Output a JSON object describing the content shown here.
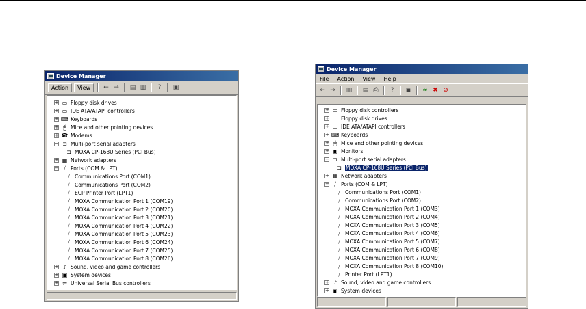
{
  "left_window": {
    "title": "Device Manager",
    "toolbar": {
      "action": "Action",
      "view": "View"
    },
    "items": [
      {
        "label": "Floppy disk drives",
        "level": 0,
        "exp": "+",
        "icon": "floppy-drive-icon",
        "glyph": "▭"
      },
      {
        "label": "IDE ATA/ATAPI controllers",
        "level": 0,
        "exp": "+",
        "icon": "ide-controller-icon",
        "glyph": "▭"
      },
      {
        "label": "Keyboards",
        "level": 0,
        "exp": "+",
        "icon": "keyboard-icon",
        "glyph": "⌨"
      },
      {
        "label": "Mice and other pointing devices",
        "level": 0,
        "exp": "+",
        "icon": "mouse-icon",
        "glyph": "🖱"
      },
      {
        "label": "Modems",
        "level": 0,
        "exp": "+",
        "icon": "modem-icon",
        "glyph": "☎"
      },
      {
        "label": "Multi-port serial adapters",
        "level": 0,
        "exp": "−",
        "icon": "serial-adapter-icon",
        "glyph": "⊐"
      },
      {
        "label": "MOXA CP-168U Series (PCI Bus)",
        "level": 1,
        "exp": "",
        "icon": "serial-adapter-icon",
        "glyph": "⊐"
      },
      {
        "label": "Network adapters",
        "level": 0,
        "exp": "+",
        "icon": "network-adapter-icon",
        "glyph": "▦"
      },
      {
        "label": "Ports (COM & LPT)",
        "level": 0,
        "exp": "−",
        "icon": "port-icon",
        "glyph": "⧸"
      },
      {
        "label": "Communications Port (COM1)",
        "level": 1,
        "exp": "",
        "icon": "port-icon",
        "glyph": "⧸"
      },
      {
        "label": "Communications Port (COM2)",
        "level": 1,
        "exp": "",
        "icon": "port-icon",
        "glyph": "⧸"
      },
      {
        "label": "ECP Printer Port (LPT1)",
        "level": 1,
        "exp": "",
        "icon": "port-icon",
        "glyph": "⧸"
      },
      {
        "label": "MOXA Communication Port 1 (COM19)",
        "level": 1,
        "exp": "",
        "icon": "port-icon",
        "glyph": "⧸"
      },
      {
        "label": "MOXA Communication Port 2 (COM20)",
        "level": 1,
        "exp": "",
        "icon": "port-icon",
        "glyph": "⧸"
      },
      {
        "label": "MOXA Communication Port 3 (COM21)",
        "level": 1,
        "exp": "",
        "icon": "port-icon",
        "glyph": "⧸"
      },
      {
        "label": "MOXA Communication Port 4 (COM22)",
        "level": 1,
        "exp": "",
        "icon": "port-icon",
        "glyph": "⧸"
      },
      {
        "label": "MOXA Communication Port 5 (COM23)",
        "level": 1,
        "exp": "",
        "icon": "port-icon",
        "glyph": "⧸"
      },
      {
        "label": "MOXA Communication Port 6 (COM24)",
        "level": 1,
        "exp": "",
        "icon": "port-icon",
        "glyph": "⧸"
      },
      {
        "label": "MOXA Communication Port 7 (COM25)",
        "level": 1,
        "exp": "",
        "icon": "port-icon",
        "glyph": "⧸"
      },
      {
        "label": "MOXA Communication Port 8 (COM26)",
        "level": 1,
        "exp": "",
        "icon": "port-icon",
        "glyph": "⧸"
      },
      {
        "label": "Sound, video and game controllers",
        "level": 0,
        "exp": "+",
        "icon": "sound-icon",
        "glyph": "♪"
      },
      {
        "label": "System devices",
        "level": 0,
        "exp": "+",
        "icon": "system-device-icon",
        "glyph": "▣"
      },
      {
        "label": "Universal Serial Bus controllers",
        "level": 0,
        "exp": "+",
        "icon": "usb-icon",
        "glyph": "⇌"
      }
    ]
  },
  "right_window": {
    "title": "Device Manager",
    "menu": {
      "file": "File",
      "action": "Action",
      "view": "View",
      "help": "Help"
    },
    "items": [
      {
        "label": "Floppy disk controllers",
        "level": 0,
        "exp": "+",
        "icon": "floppy-controller-icon",
        "glyph": "▭",
        "selected": false
      },
      {
        "label": "Floppy disk drives",
        "level": 0,
        "exp": "+",
        "icon": "floppy-drive-icon",
        "glyph": "▭",
        "selected": false
      },
      {
        "label": "IDE ATA/ATAPI controllers",
        "level": 0,
        "exp": "+",
        "icon": "ide-controller-icon",
        "glyph": "▭",
        "selected": false
      },
      {
        "label": "Keyboards",
        "level": 0,
        "exp": "+",
        "icon": "keyboard-icon",
        "glyph": "⌨",
        "selected": false
      },
      {
        "label": "Mice and other pointing devices",
        "level": 0,
        "exp": "+",
        "icon": "mouse-icon",
        "glyph": "🖱",
        "selected": false
      },
      {
        "label": "Monitors",
        "level": 0,
        "exp": "+",
        "icon": "monitor-icon",
        "glyph": "▣",
        "selected": false
      },
      {
        "label": "Multi-port serial adapters",
        "level": 0,
        "exp": "−",
        "icon": "serial-adapter-icon",
        "glyph": "⊐",
        "selected": false
      },
      {
        "label": "MOXA CP-168U Series (PCI Bus)",
        "level": 1,
        "exp": "",
        "icon": "serial-adapter-icon",
        "glyph": "⊐",
        "selected": true
      },
      {
        "label": "Network adapters",
        "level": 0,
        "exp": "+",
        "icon": "network-adapter-icon",
        "glyph": "▦",
        "selected": false
      },
      {
        "label": "Ports (COM & LPT)",
        "level": 0,
        "exp": "−",
        "icon": "port-icon",
        "glyph": "⧸",
        "selected": false
      },
      {
        "label": "Communications Port (COM1)",
        "level": 1,
        "exp": "",
        "icon": "port-icon",
        "glyph": "⧸",
        "selected": false
      },
      {
        "label": "Communications Port (COM2)",
        "level": 1,
        "exp": "",
        "icon": "port-icon",
        "glyph": "⧸",
        "selected": false
      },
      {
        "label": "MOXA Communication Port 1 (COM3)",
        "level": 1,
        "exp": "",
        "icon": "port-icon",
        "glyph": "⧸",
        "selected": false
      },
      {
        "label": "MOXA Communication Port 2 (COM4)",
        "level": 1,
        "exp": "",
        "icon": "port-icon",
        "glyph": "⧸",
        "selected": false
      },
      {
        "label": "MOXA Communication Port 3 (COM5)",
        "level": 1,
        "exp": "",
        "icon": "port-icon",
        "glyph": "⧸",
        "selected": false
      },
      {
        "label": "MOXA Communication Port 4 (COM6)",
        "level": 1,
        "exp": "",
        "icon": "port-icon",
        "glyph": "⧸",
        "selected": false
      },
      {
        "label": "MOXA Communication Port 5 (COM7)",
        "level": 1,
        "exp": "",
        "icon": "port-icon",
        "glyph": "⧸",
        "selected": false
      },
      {
        "label": "MOXA Communication Port 6 (COM8)",
        "level": 1,
        "exp": "",
        "icon": "port-icon",
        "glyph": "⧸",
        "selected": false
      },
      {
        "label": "MOXA Communication Port 7 (COM9)",
        "level": 1,
        "exp": "",
        "icon": "port-icon",
        "glyph": "⧸",
        "selected": false
      },
      {
        "label": "MOXA Communication Port 8 (COM10)",
        "level": 1,
        "exp": "",
        "icon": "port-icon",
        "glyph": "⧸",
        "selected": false
      },
      {
        "label": "Printer Port (LPT1)",
        "level": 1,
        "exp": "",
        "icon": "port-icon",
        "glyph": "⧸",
        "selected": false
      },
      {
        "label": "Sound, video and game controllers",
        "level": 0,
        "exp": "+",
        "icon": "sound-icon",
        "glyph": "♪",
        "selected": false
      },
      {
        "label": "System devices",
        "level": 0,
        "exp": "+",
        "icon": "system-device-icon",
        "glyph": "▣",
        "selected": false
      }
    ]
  },
  "colors": {
    "selection": "#0a246a",
    "titlebar": "#0a246a",
    "face": "#d4d0c8"
  }
}
